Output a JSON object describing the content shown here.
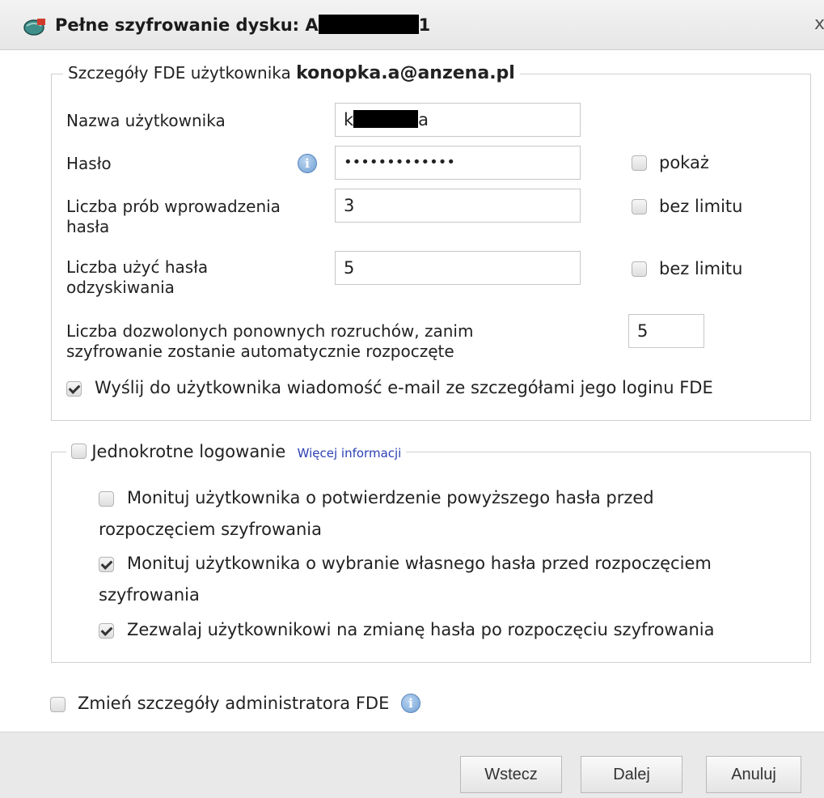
{
  "window": {
    "title_prefix": "Pełne szyfrowanie dysku: A",
    "title_suffix": "1",
    "close_glyph": "x"
  },
  "fde_group": {
    "legend_prefix": "Szczegóły FDE użytkownika",
    "legend_user": "konopka.a@anzena.pl",
    "username": {
      "label": "Nazwa użytkownika",
      "value_prefix": "k",
      "value_suffix": "a"
    },
    "password": {
      "label": "Hasło",
      "value": "•••••••••••••",
      "show_label": "pokaż",
      "show_checked": false
    },
    "attempts": {
      "label_line1": "Liczba prób wprowadzenia",
      "label_line2": "hasła",
      "value": "3",
      "unlimited_label": "bez limitu",
      "unlimited_checked": false
    },
    "recovery": {
      "label_line1": "Liczba użyć hasła",
      "label_line2": "odzyskiwania",
      "value": "5",
      "unlimited_label": "bez limitu",
      "unlimited_checked": false
    },
    "reboots": {
      "label_line1": "Liczba dozwolonych ponownych rozruchów, zanim",
      "label_line2": "szyfrowanie zostanie automatycznie rozpoczęte",
      "value": "5"
    },
    "send_email": {
      "label": "Wyślij do użytkownika wiadomość e-mail ze szczegółami jego loginu FDE",
      "checked": true
    }
  },
  "sso_group": {
    "legend": "Jednokrotne logowanie",
    "legend_checked": false,
    "more_info": "Więcej informacji",
    "options": [
      {
        "line1": "Monituj użytkownika o potwierdzenie powyższego hasła przed",
        "line2": "rozpoczęciem szyfrowania",
        "checked": false
      },
      {
        "line1": "Monituj użytkownika o wybranie własnego hasła przed rozpoczęciem",
        "line2": "szyfrowania",
        "checked": true
      },
      {
        "line1": "Zezwalaj użytkownikowi na zmianę hasła po rozpoczęciu szyfrowania",
        "line2": "",
        "checked": true
      }
    ]
  },
  "admin": {
    "label": "Zmień szczegóły administratora FDE",
    "checked": false
  },
  "info_glyph": "i",
  "buttons": {
    "back": "Wstecz",
    "next": "Dalej",
    "cancel": "Anuluj"
  },
  "icons": {
    "app": "shield-globe-icon",
    "info": "info-icon",
    "close": "close-icon"
  }
}
